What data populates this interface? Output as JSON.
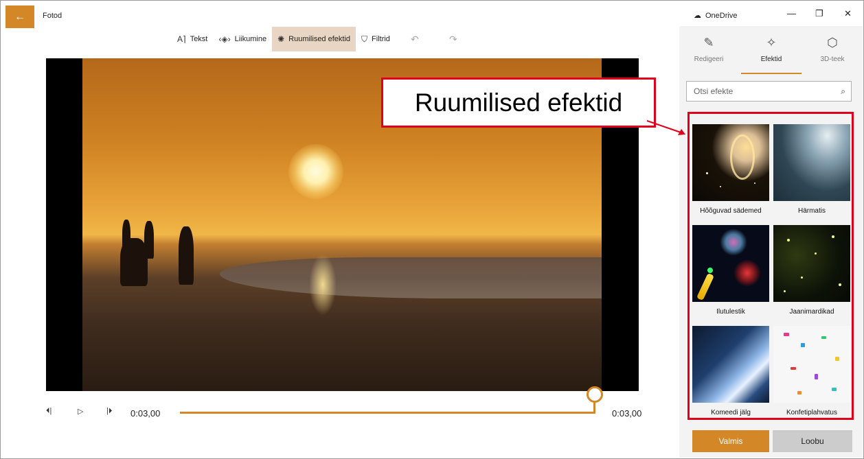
{
  "app": {
    "title": "Fotod",
    "back_icon": "arrow-left-icon"
  },
  "toolbar": {
    "items": [
      {
        "label": "Tekst",
        "icon": "text-icon"
      },
      {
        "label": "Liikumine",
        "icon": "motion-icon"
      },
      {
        "label": "Ruumilised efektid",
        "icon": "sparkle-effects-icon",
        "active": true
      },
      {
        "label": "Filtrid",
        "icon": "filter-icon"
      }
    ],
    "undo_icon": "undo-icon",
    "redo_icon": "redo-icon"
  },
  "playback": {
    "time_current": "0:03,00",
    "time_total": "0:03,00",
    "progress": 1.0
  },
  "window": {
    "onedrive": "OneDrive",
    "minimize": "—",
    "maximize": "❐",
    "close": "✕"
  },
  "panel": {
    "tabs": [
      {
        "label": "Redigeeri",
        "icon": "pencil-icon"
      },
      {
        "label": "Efektid",
        "icon": "sparkle-icon",
        "active": true
      },
      {
        "label": "3D-teek",
        "icon": "cube-icon"
      }
    ],
    "search_placeholder": "Otsi efekte",
    "effects": [
      {
        "label": "Hõõguvad sädemed"
      },
      {
        "label": "Härmatis"
      },
      {
        "label": "Ilutulestik"
      },
      {
        "label": "Jaanimardikad"
      },
      {
        "label": "Komeedi jälg"
      },
      {
        "label": "Konfetiplahvatus"
      }
    ],
    "ok_label": "Valmis",
    "cancel_label": "Loobu"
  },
  "annotation": {
    "label": "Ruumilised efektid"
  },
  "colors": {
    "accent": "#d48726",
    "annotation": "#e0001b"
  }
}
